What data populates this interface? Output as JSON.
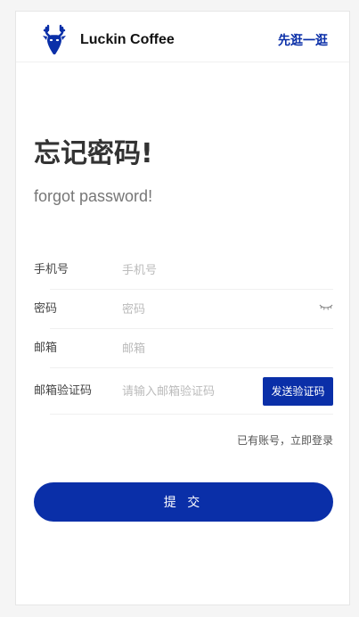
{
  "header": {
    "brand": "Luckin Coffee",
    "browse_link": "先逛一逛"
  },
  "title": "忘记密码!",
  "subtitle": "forgot password!",
  "form": {
    "phone": {
      "label": "手机号",
      "placeholder": "手机号",
      "value": ""
    },
    "password": {
      "label": "密码",
      "placeholder": "密码",
      "value": ""
    },
    "email": {
      "label": "邮箱",
      "placeholder": "邮箱",
      "value": ""
    },
    "email_code": {
      "label": "邮箱验证码",
      "placeholder": "请输入邮箱验证码",
      "value": ""
    },
    "send_code_button": "发送验证码"
  },
  "login_link": "已有账号，立即登录",
  "submit_button": "提 交",
  "colors": {
    "brand_blue": "#0a2fa8",
    "title_text": "#333333",
    "placeholder": "#bbbbbb"
  },
  "icons": {
    "logo": "luckin-deer-logo-icon",
    "password_toggle": "eye-closed-icon"
  }
}
